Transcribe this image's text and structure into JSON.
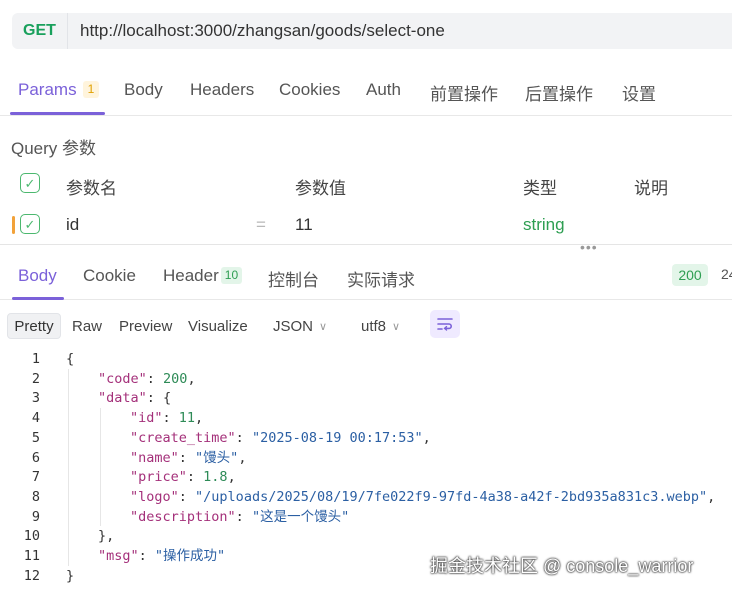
{
  "request": {
    "method": "GET",
    "url": "http://localhost:3000/zhangsan/goods/select-one",
    "tabs": [
      {
        "label": "Params",
        "badge": "1"
      },
      {
        "label": "Body"
      },
      {
        "label": "Headers"
      },
      {
        "label": "Cookies"
      },
      {
        "label": "Auth"
      },
      {
        "label": "前置操作"
      },
      {
        "label": "后置操作"
      },
      {
        "label": "设置"
      }
    ]
  },
  "query": {
    "title": "Query 参数",
    "headers": {
      "name": "参数名",
      "value": "参数值",
      "type": "类型",
      "desc": "说明"
    },
    "rows": [
      {
        "name": "id",
        "eq": "=",
        "value": "11",
        "type": "string",
        "desc": ""
      }
    ]
  },
  "response": {
    "tabs": [
      {
        "label": "Body"
      },
      {
        "label": "Cookie"
      },
      {
        "label": "Header",
        "badge": "10"
      },
      {
        "label": "控制台"
      },
      {
        "label": "实际请求"
      }
    ],
    "status": "200",
    "status_extra": "24",
    "format": {
      "modes": [
        "Pretty",
        "Raw",
        "Preview",
        "Visualize"
      ],
      "content_type": "JSON",
      "encoding": "utf8"
    },
    "code_lines": [
      {
        "num": "1",
        "indent": 0,
        "tokens": [
          {
            "t": "{",
            "c": "p"
          }
        ]
      },
      {
        "num": "2",
        "indent": 1,
        "tokens": [
          {
            "t": "\"code\"",
            "c": "k"
          },
          {
            "t": ": ",
            "c": "p"
          },
          {
            "t": "200",
            "c": "n"
          },
          {
            "t": ",",
            "c": "p"
          }
        ]
      },
      {
        "num": "3",
        "indent": 1,
        "tokens": [
          {
            "t": "\"data\"",
            "c": "k"
          },
          {
            "t": ": {",
            "c": "p"
          }
        ]
      },
      {
        "num": "4",
        "indent": 2,
        "tokens": [
          {
            "t": "\"id\"",
            "c": "k"
          },
          {
            "t": ": ",
            "c": "p"
          },
          {
            "t": "11",
            "c": "n"
          },
          {
            "t": ",",
            "c": "p"
          }
        ]
      },
      {
        "num": "5",
        "indent": 2,
        "tokens": [
          {
            "t": "\"create_time\"",
            "c": "k"
          },
          {
            "t": ": ",
            "c": "p"
          },
          {
            "t": "\"2025-08-19 00:17:53\"",
            "c": "s"
          },
          {
            "t": ",",
            "c": "p"
          }
        ]
      },
      {
        "num": "6",
        "indent": 2,
        "tokens": [
          {
            "t": "\"name\"",
            "c": "k"
          },
          {
            "t": ": ",
            "c": "p"
          },
          {
            "t": "\"馒头\"",
            "c": "s"
          },
          {
            "t": ",",
            "c": "p"
          }
        ]
      },
      {
        "num": "7",
        "indent": 2,
        "tokens": [
          {
            "t": "\"price\"",
            "c": "k"
          },
          {
            "t": ": ",
            "c": "p"
          },
          {
            "t": "1.8",
            "c": "n"
          },
          {
            "t": ",",
            "c": "p"
          }
        ]
      },
      {
        "num": "8",
        "indent": 2,
        "tokens": [
          {
            "t": "\"logo\"",
            "c": "k"
          },
          {
            "t": ": ",
            "c": "p"
          },
          {
            "t": "\"/uploads/2025/08/19/7fe022f9-97fd-4a38-a42f-2bd935a831c3.webp\"",
            "c": "s"
          },
          {
            "t": ",",
            "c": "p"
          }
        ]
      },
      {
        "num": "9",
        "indent": 2,
        "tokens": [
          {
            "t": "\"description\"",
            "c": "k"
          },
          {
            "t": ": ",
            "c": "p"
          },
          {
            "t": "\"这是一个馒头\"",
            "c": "s"
          }
        ]
      },
      {
        "num": "10",
        "indent": 1,
        "tokens": [
          {
            "t": "},",
            "c": "p"
          }
        ]
      },
      {
        "num": "11",
        "indent": 1,
        "tokens": [
          {
            "t": "\"msg\"",
            "c": "k"
          },
          {
            "t": ": ",
            "c": "p"
          },
          {
            "t": "\"操作成功\"",
            "c": "s"
          }
        ]
      },
      {
        "num": "12",
        "indent": 0,
        "tokens": [
          {
            "t": "}",
            "c": "p"
          }
        ]
      }
    ]
  },
  "watermark": "掘金技术社区 @ console_warrior",
  "colors": {
    "accent": "#7b61d9",
    "method_get": "#19a05c",
    "status_ok": "#2e9e52",
    "json_key": "#a4307a",
    "json_string": "#2b5fa3",
    "json_number": "#2e8b57"
  },
  "icons": {
    "checkbox": "check-icon",
    "dropdown": "chevron-down-icon",
    "wrap": "word-wrap-icon",
    "resize": "drag-handle-icon"
  }
}
